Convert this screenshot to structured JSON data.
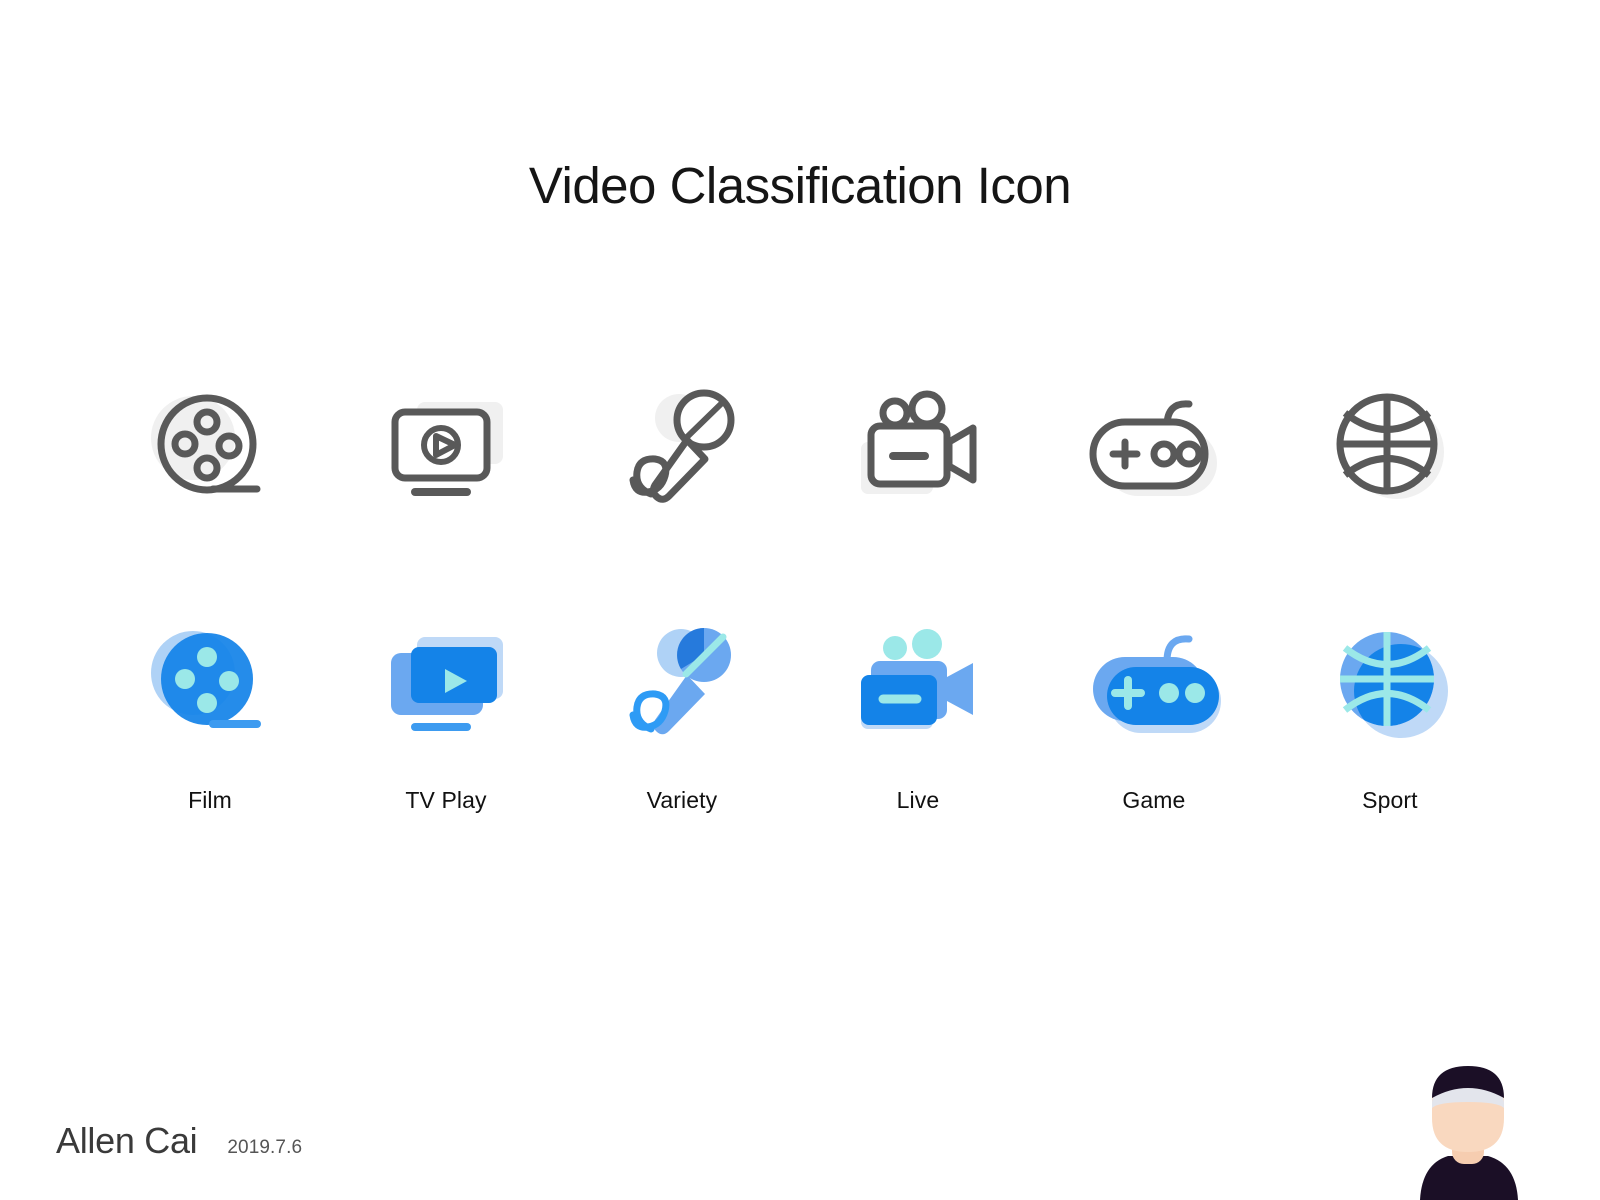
{
  "header": {
    "title": "Video Classification Icon"
  },
  "palette": {
    "outline_gray": "#595959",
    "shadow_gray": "#F0F0F0",
    "blue_primary": "#1483E8",
    "blue_medium": "#6BA8F0",
    "blue_pale": "#BFD9F7",
    "cyan_light": "#9BE8E8",
    "text_dark": "#151515"
  },
  "icons": {
    "outline_row": [
      {
        "name": "film-reel-icon",
        "style": "outline"
      },
      {
        "name": "tv-play-icon",
        "style": "outline"
      },
      {
        "name": "microphone-icon",
        "style": "outline"
      },
      {
        "name": "video-camera-icon",
        "style": "outline"
      },
      {
        "name": "gamepad-icon",
        "style": "outline"
      },
      {
        "name": "basketball-icon",
        "style": "outline"
      }
    ],
    "filled_row": [
      {
        "name": "film-reel-icon",
        "style": "filled",
        "label": "Film"
      },
      {
        "name": "tv-play-icon",
        "style": "filled",
        "label": "TV Play"
      },
      {
        "name": "microphone-icon",
        "style": "filled",
        "label": "Variety"
      },
      {
        "name": "video-camera-icon",
        "style": "filled",
        "label": "Live"
      },
      {
        "name": "gamepad-icon",
        "style": "filled",
        "label": "Game"
      },
      {
        "name": "basketball-icon",
        "style": "filled",
        "label": "Sport"
      }
    ]
  },
  "labels": {
    "film": "Film",
    "tv_play": "TV Play",
    "variety": "Variety",
    "live": "Live",
    "game": "Game",
    "sport": "Sport"
  },
  "footer": {
    "author": "Allen Cai",
    "date": "2019.7.6"
  }
}
